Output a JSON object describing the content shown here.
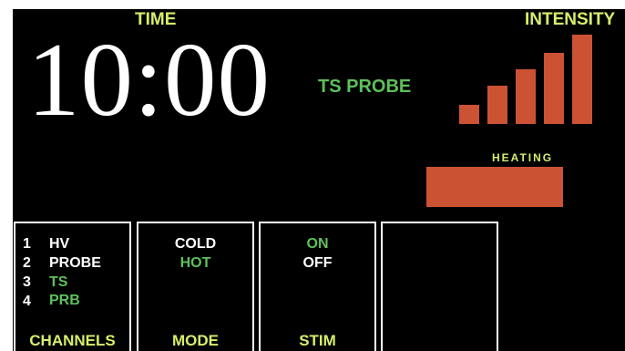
{
  "time": {
    "label": "TIME",
    "value": "10:00"
  },
  "probe_title": "TS PROBE",
  "intensity": {
    "label": "INTENSITY",
    "level": 5,
    "max": 5
  },
  "heating": {
    "label": "HEATING",
    "level_fraction": 1.0
  },
  "panels": {
    "channels": {
      "items": [
        {
          "number": "1",
          "name": "HV",
          "selected": false
        },
        {
          "number": "2",
          "name": "PROBE",
          "selected": false
        },
        {
          "number": "3",
          "name": "TS PRB",
          "selected": true
        },
        {
          "number": "4",
          "name": "",
          "selected": false
        }
      ],
      "label": "CHANNELS"
    },
    "mode": {
      "options": [
        {
          "name": "COLD",
          "selected": false
        },
        {
          "name": "HOT",
          "selected": true
        }
      ],
      "label": "MODE"
    },
    "stim": {
      "options": [
        {
          "name": "ON",
          "selected": true
        },
        {
          "name": "OFF",
          "selected": false
        }
      ],
      "label": "STIM"
    }
  },
  "colors": {
    "background": "#000000",
    "label_yellow": "#d7ee6a",
    "active_green": "#5cc15a",
    "bar_orange": "#cc5234"
  }
}
